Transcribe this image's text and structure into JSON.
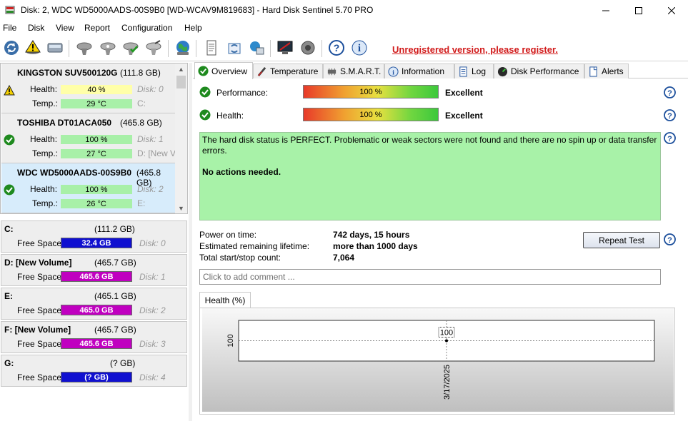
{
  "window": {
    "title": "Disk: 2, WDC WD5000AADS-00S9B0 [WD-WCAV9M819683]  -  Hard Disk Sentinel 5.70 PRO"
  },
  "menu": [
    "File",
    "Disk",
    "View",
    "Report",
    "Configuration",
    "Help"
  ],
  "toolbar": {
    "unregistered": "Unregistered version, please register."
  },
  "disks": [
    {
      "name": "KINGSTON SUV500120G",
      "size": "(111.8 GB)",
      "health_label": "Health:",
      "health": "40 %",
      "health_pct": 40,
      "temp_label": "Temp.:",
      "temp": "29 °C",
      "disk_ref": "Disk: 0",
      "drive": "C:",
      "status": "warning"
    },
    {
      "name": "TOSHIBA DT01ACA050",
      "size": "(465.8 GB)",
      "health_label": "Health:",
      "health": "100 %",
      "health_pct": 100,
      "temp_label": "Temp.:",
      "temp": "27 °C",
      "disk_ref": "Disk: 1",
      "drive": "D: [New V",
      "status": "ok"
    },
    {
      "name": "WDC WD5000AADS-00S9B0",
      "size": "(465.8 GB)",
      "health_label": "Health:",
      "health": "100 %",
      "health_pct": 100,
      "temp_label": "Temp.:",
      "temp": "26 °C",
      "disk_ref": "Disk: 2",
      "drive": "E:",
      "status": "ok"
    }
  ],
  "volumes": [
    {
      "name": "C:",
      "size": "(111.2 GB)",
      "free_label": "Free Space",
      "free": "32.4 GB",
      "disk_ref": "Disk: 0",
      "color": "#1010d0"
    },
    {
      "name": "D: [New Volume]",
      "size": "(465.7 GB)",
      "free_label": "Free Space",
      "free": "465.6 GB",
      "disk_ref": "Disk: 1",
      "color": "#c000c0"
    },
    {
      "name": "E:",
      "size": "(465.1 GB)",
      "free_label": "Free Space",
      "free": "465.0 GB",
      "disk_ref": "Disk: 2",
      "color": "#c000c0"
    },
    {
      "name": "F: [New Volume]",
      "size": "(465.7 GB)",
      "free_label": "Free Space",
      "free": "465.6 GB",
      "disk_ref": "Disk: 3",
      "color": "#c000c0"
    },
    {
      "name": "G:",
      "size": "(? GB)",
      "free_label": "Free Space",
      "free": "(? GB)",
      "disk_ref": "Disk: 4",
      "color": "#1010d0"
    }
  ],
  "tabs": [
    "Overview",
    "Temperature",
    "S.M.A.R.T.",
    "Information",
    "Log",
    "Disk Performance",
    "Alerts"
  ],
  "overview": {
    "performance_label": "Performance:",
    "performance_value": "100 %",
    "performance_rating": "Excellent",
    "health_label": "Health:",
    "health_value": "100 %",
    "health_rating": "Excellent",
    "status_text": "The hard disk status is PERFECT. Problematic or weak sectors were not found and there are no spin up or data transfer errors.",
    "status_action": "No actions needed.",
    "power_on_label": "Power on time:",
    "power_on_value": "742 days, 15 hours",
    "lifetime_label": "Estimated remaining lifetime:",
    "lifetime_value": "more than 1000 days",
    "startstop_label": "Total start/stop count:",
    "startstop_value": "7,064",
    "repeat_test": "Repeat Test",
    "comment_placeholder": "Click to add comment ...",
    "health_tab": "Health (%)"
  },
  "chart_data": {
    "type": "line",
    "x": [
      "3/17/2025"
    ],
    "series": [
      {
        "values": [
          100
        ]
      }
    ],
    "ytick_labels": [
      "100"
    ],
    "data_labels": [
      "100"
    ],
    "grid": true
  }
}
